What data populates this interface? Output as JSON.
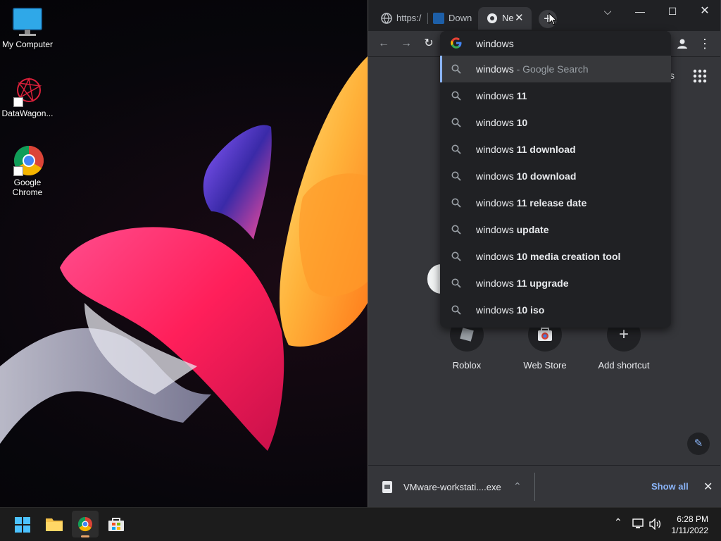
{
  "desktop": {
    "icons": [
      {
        "label": "My Computer"
      },
      {
        "label": "DataWagon..."
      },
      {
        "label": "Google Chrome"
      }
    ]
  },
  "chrome": {
    "tabs": [
      {
        "title": "https:/"
      },
      {
        "title": "Down"
      },
      {
        "title": "Ne",
        "active": true
      }
    ],
    "omnibox": {
      "value": "windows",
      "selected_hint": " - Google Search",
      "suggestions": [
        {
          "typed": "windows",
          "completion": ""
        },
        {
          "typed": "windows",
          "completion": " 11"
        },
        {
          "typed": "windows",
          "completion": " 10"
        },
        {
          "typed": "windows",
          "completion": " 11 download"
        },
        {
          "typed": "windows",
          "completion": " 10 download"
        },
        {
          "typed": "windows",
          "completion": " 11 release date"
        },
        {
          "typed": "windows",
          "completion": " update"
        },
        {
          "typed": "windows",
          "completion": " 10 media creation tool"
        },
        {
          "typed": "windows",
          "completion": " 11 upgrade"
        },
        {
          "typed": "windows",
          "completion": " 10 iso"
        }
      ]
    },
    "ntp": {
      "partial_text": "s",
      "shortcuts": [
        {
          "label": "Roblox"
        },
        {
          "label": "Web Store"
        },
        {
          "label": "Add shortcut"
        }
      ]
    },
    "download": {
      "filename": "VMware-workstati....exe",
      "show_all": "Show all"
    }
  },
  "taskbar": {
    "time": "6:28 PM",
    "date": "1/11/2022"
  },
  "colors": {
    "accent": "#8ab4f8",
    "dark_bg": "#202124",
    "panel_bg": "#35363a"
  }
}
